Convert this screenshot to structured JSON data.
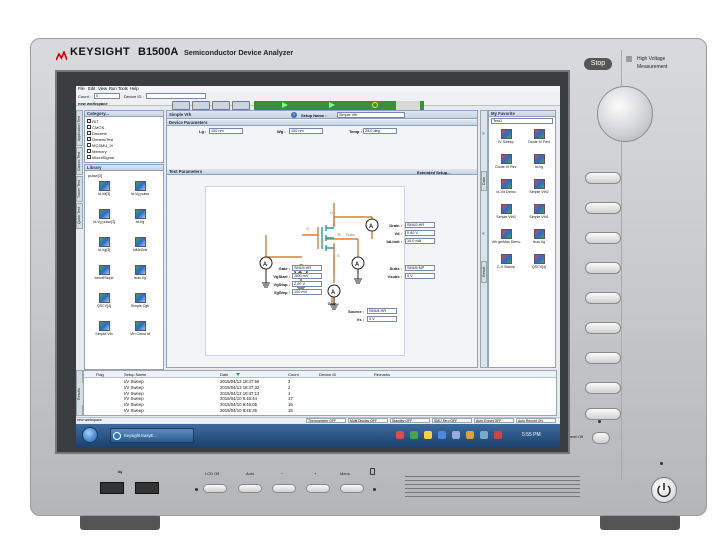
{
  "instrument": {
    "brand": "KEYSIGHT",
    "model": "B1500A",
    "model_desc": "Semiconductor Device Analyzer",
    "stop_label": "Stop",
    "hv_label1": "High Voltage",
    "hv_label2": "Measurement",
    "touch_panel": "Touch Panel Off",
    "bottom_buttons": [
      "LCD Off",
      "Auto",
      "−",
      "+",
      "Menu"
    ]
  },
  "menu": [
    "File",
    "Edit",
    "View",
    "Run",
    "Tools",
    "Help"
  ],
  "toolbar": {
    "count_label": "Count :",
    "count_value": "0",
    "device_label": "Device ID :",
    "workspace": "new workspace"
  },
  "left": {
    "category_header": "Category...",
    "categories": [
      "RIT",
      "CMOS",
      "Discrete",
      "GenericTest",
      "MCSMU_IV",
      "Memory",
      "MixedSignal"
    ],
    "library_header": "Library",
    "library_items": [
      "pulse[3]",
      "Id-Vd[3]",
      "Id-Vg pulse",
      "Id-Vg pulse[3]",
      "Id-Vg",
      "Id-Vg[3]",
      "IdMeGds",
      "IonIoffSlope",
      "Isub-Vg",
      "QSCV[4]",
      "Simple Cgb",
      "Simple Vth",
      "Vth Const Id"
    ],
    "tabs": [
      "Application Test",
      "Classic Test",
      "Tracer Test",
      "Quick Test"
    ]
  },
  "setup": {
    "title": "Simple Vth",
    "setup_name_label": "Setup Name :",
    "setup_name_value": "Simple Vth",
    "device_params": "Device Parameters",
    "lg_label": "Lg :",
    "lg_value": "100 nm",
    "wg_label": "Wg :",
    "wg_value": "100 nm",
    "temp_label": "Temp :",
    "temp_value": "25.0 deg",
    "test_params": "Test Parameters",
    "extended": "Extended Setup...",
    "gate_label": "Gate :",
    "gate_value": "SMU3:HR",
    "vgstart_label": "VgStart :",
    "vgstart_value": "-500 mV",
    "vgstop_label": "VgStop :",
    "vgstop_value": "2.00 V",
    "vgstep_label": "VgStep :",
    "vgstep_value": "100 mV",
    "drain_label": "Drain :",
    "drain_value": "SMU2:HR",
    "vd_label": "Vd :",
    "vd_value": "0.60 V",
    "idlimit_label": "IdLimit :",
    "idlimit_value": "10.0 mA",
    "subs_label": "Subs :",
    "subs_value": "SMU5:MP",
    "vsubs_label": "Vsubs :",
    "vsubs_value": "0 V",
    "source_label": "Source :",
    "source_value": "SMU4:HR",
    "vs_label": "Vs :",
    "vs_value": "0 V",
    "node_d": "D",
    "node_g": "G",
    "node_s": "S",
    "node_b": "B",
    "node_subs": "Subs"
  },
  "favorite": {
    "header": "My Favorite",
    "group": "Test1",
    "items": [
      "IV Sweep",
      "Diode IV Fwd",
      "Diode IV Rev",
      "Id-Vg",
      "Id-Vd Demo",
      "Simple Vth2",
      "Simple Vth3",
      "Simple Vth1",
      "Vth gmMax Demo",
      "Isub-Vg",
      "C-V Sweep",
      "QSCV[4]"
    ],
    "tabs": [
      "Data",
      "Result"
    ]
  },
  "results": {
    "tab": "Results",
    "columns": [
      "Flag",
      "Setup Name",
      "Date",
      "Count",
      "Device ID",
      "Remarks"
    ],
    "rows": [
      [
        "",
        "I/V Sweep",
        "2015/04/13 18:47:56",
        "3",
        "",
        ""
      ],
      [
        "",
        "I/V Sweep",
        "2015/04/13 18:47:32",
        "2",
        "",
        ""
      ],
      [
        "",
        "I/V Sweep",
        "2015/04/13 18:47:13",
        "1",
        "",
        ""
      ],
      [
        "",
        "I/V Sweep",
        "2015/04/10 9:46:44",
        "17",
        "",
        ""
      ],
      [
        "",
        "I/V Sweep",
        "2015/04/10 9:46:05",
        "16",
        "",
        ""
      ],
      [
        "",
        "I/V Sweep",
        "2015/04/10 9:45:35",
        "15",
        "",
        ""
      ]
    ]
  },
  "status": {
    "workspace": "new workspace",
    "indicators": [
      "Thermometer OFF",
      "Multi Display OFF",
      "Standby OFF",
      "SMU Zero OFF",
      "Auto Export OFF",
      "Auto Record ON"
    ]
  },
  "taskbar": {
    "app": "Keysight EasyE...",
    "time": "5:55 PM"
  },
  "colors": {
    "accent": "#3b6fc6",
    "run_green": "#2ea43c",
    "panel_border": "#8fa3bd"
  }
}
